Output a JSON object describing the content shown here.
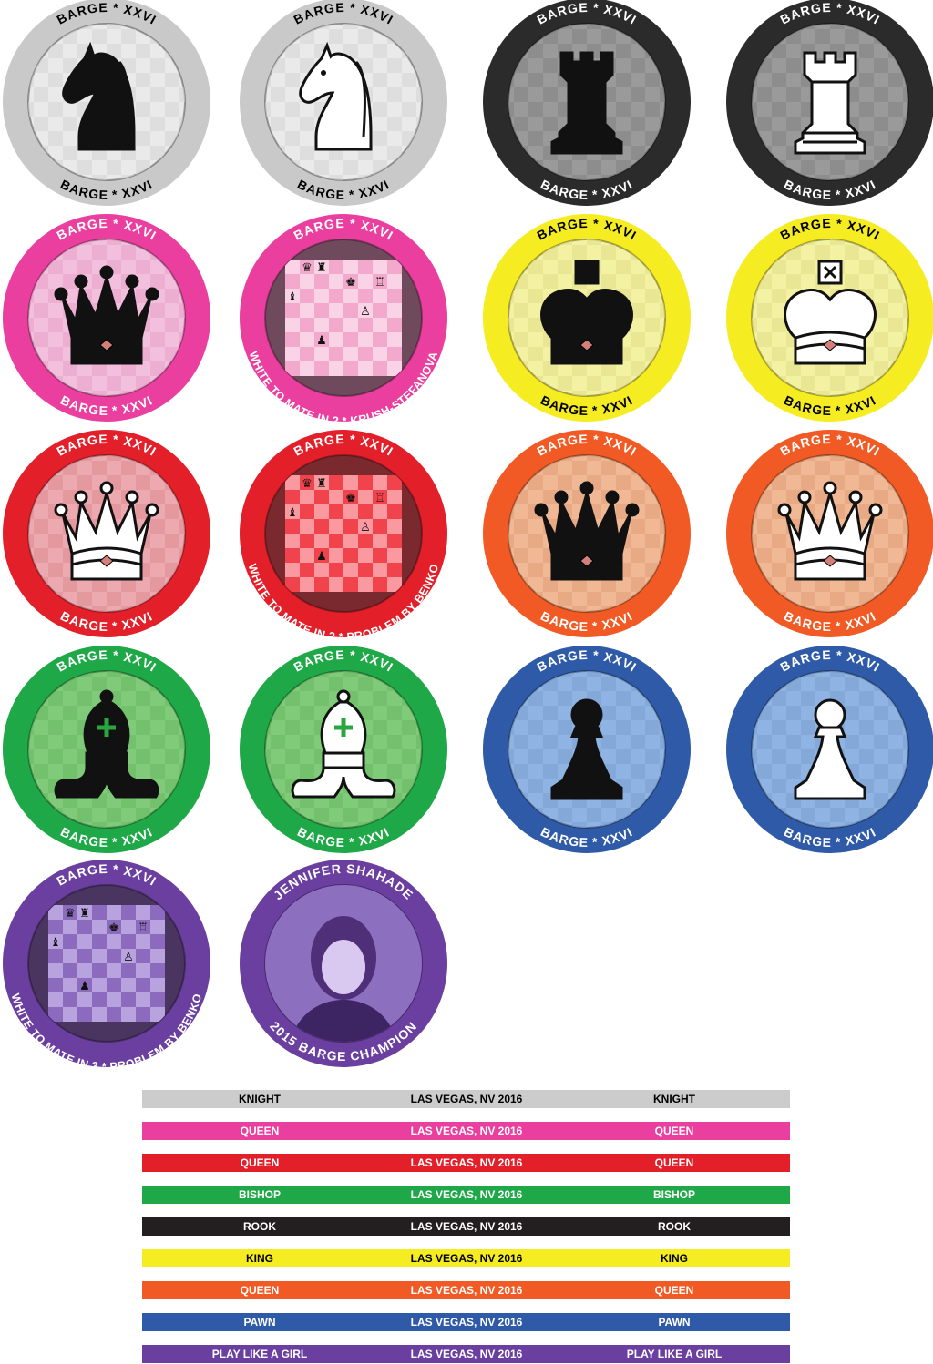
{
  "chips": [
    {
      "id": "knight-black",
      "ring": "#c9c9c9",
      "inner": "#eaeaea",
      "check": "#d5d5d5",
      "ringText": "#000000",
      "top": "BARGE * XXVI",
      "bottom": "BARGE * XXVI",
      "piece": "knight",
      "fill": "black"
    },
    {
      "id": "knight-white",
      "ring": "#c9c9c9",
      "inner": "#eaeaea",
      "check": "#d5d5d5",
      "ringText": "#000000",
      "top": "BARGE * XXVI",
      "bottom": "BARGE * XXVI",
      "piece": "knight",
      "fill": "white"
    },
    {
      "id": "rook-black",
      "ring": "#2b2b2b",
      "inner": "#9a9a9a",
      "check": "#858585",
      "ringText": "#ffffff",
      "top": "BARGE * XXVI",
      "bottom": "BARGE * XXVI",
      "piece": "rook",
      "fill": "black"
    },
    {
      "id": "rook-white",
      "ring": "#2b2b2b",
      "inner": "#9a9a9a",
      "check": "#858585",
      "ringText": "#ffffff",
      "top": "BARGE * XXVI",
      "bottom": "BARGE * XXVI",
      "piece": "rook",
      "fill": "white"
    },
    {
      "id": "queen-pink-black",
      "ring": "#ea3f9f",
      "inner": "#f2c0dc",
      "check": "#e7a3c9",
      "ringText": "#ffffff",
      "top": "BARGE * XXVI",
      "bottom": "BARGE * XXVI",
      "piece": "queen",
      "fill": "black"
    },
    {
      "id": "problem-pink",
      "ring": "#ea3f9f",
      "inner": "#6e4a5c",
      "check": "#f2a9cc",
      "light": "#fbd3e6",
      "ringText": "#ffffff",
      "top": "BARGE * XXVI",
      "arc": "WHITE TO MATE IN 2 * KRUSH-STEFANOVA",
      "piece": "board"
    },
    {
      "id": "king-yellow-black",
      "ring": "#f6ec22",
      "inner": "#f3f2a3",
      "check": "#e3e08a",
      "ringText": "#000000",
      "top": "BARGE * XXVI",
      "bottom": "BARGE * XXVI",
      "piece": "king",
      "fill": "black"
    },
    {
      "id": "king-yellow-white",
      "ring": "#f6ec22",
      "inner": "#f3f2a3",
      "check": "#e3e08a",
      "ringText": "#000000",
      "top": "BARGE * XXVI",
      "bottom": "BARGE * XXVI",
      "piece": "king",
      "fill": "white"
    },
    {
      "id": "queen-red-white",
      "ring": "#e31f2a",
      "inner": "#ecaab0",
      "check": "#df8e95",
      "ringText": "#ffffff",
      "top": "BARGE * XXVI",
      "bottom": "BARGE * XXVI",
      "piece": "queen",
      "fill": "white"
    },
    {
      "id": "problem-red",
      "ring": "#e31f2a",
      "inner": "#7a2a2e",
      "check": "#f0434c",
      "light": "#fa9aa0",
      "ringText": "#ffffff",
      "top": "BARGE * XXVI",
      "arc": "WHITE TO MATE IN 2 * PROBLEM BY BENKO",
      "piece": "board"
    },
    {
      "id": "queen-orange-black",
      "ring": "#f15a24",
      "inner": "#f0b894",
      "check": "#e3a07a",
      "ringText": "#ffffff",
      "top": "BARGE * XXVI",
      "bottom": "BARGE * XXVI",
      "piece": "queen",
      "fill": "black"
    },
    {
      "id": "queen-orange-white",
      "ring": "#f15a24",
      "inner": "#f0b894",
      "check": "#e3a07a",
      "ringText": "#ffffff",
      "top": "BARGE * XXVI",
      "bottom": "BARGE * XXVI",
      "piece": "queen",
      "fill": "white"
    },
    {
      "id": "bishop-green-black",
      "ring": "#1fa847",
      "inner": "#7fcb79",
      "check": "#6bbb66",
      "ringText": "#ffffff",
      "top": "BARGE * XXVI",
      "bottom": "BARGE * XXVI",
      "piece": "bishop",
      "fill": "black"
    },
    {
      "id": "bishop-green-white",
      "ring": "#1fa847",
      "inner": "#7fcb79",
      "check": "#6bbb66",
      "ringText": "#ffffff",
      "top": "BARGE * XXVI",
      "bottom": "BARGE * XXVI",
      "piece": "bishop",
      "fill": "white"
    },
    {
      "id": "pawn-blue-black",
      "ring": "#2e5aa8",
      "inner": "#8fb3e2",
      "check": "#7da2d4",
      "ringText": "#ffffff",
      "top": "BARGE * XXVI",
      "bottom": "BARGE * XXVI",
      "piece": "pawn",
      "fill": "black"
    },
    {
      "id": "pawn-blue-white",
      "ring": "#2e5aa8",
      "inner": "#8fb3e2",
      "check": "#7da2d4",
      "ringText": "#ffffff",
      "top": "BARGE * XXVI",
      "bottom": "BARGE * XXVI",
      "piece": "pawn",
      "fill": "white"
    },
    {
      "id": "problem-purple",
      "ring": "#6a3fa0",
      "inner": "#4a3560",
      "check": "#8c6bbf",
      "light": "#b9a3de",
      "ringText": "#ffffff",
      "top": "BARGE * XXVI",
      "arc": "WHITE TO MATE IN 3 * PROBLEM BY BENKO",
      "piece": "board"
    },
    {
      "id": "champion-purple",
      "ring": "#6a3fa0",
      "inner": "#8d6fc0",
      "check": "#8d6fc0",
      "ringText": "#ffffff",
      "top": "JENNIFER SHAHADE",
      "bottom": "2015 BARGE CHAMPION",
      "piece": "portrait"
    }
  ],
  "strips": [
    {
      "color": "#cccccc",
      "text": "#000000",
      "left": "KNIGHT",
      "center": "LAS VEGAS, NV 2016",
      "right": "KNIGHT"
    },
    {
      "color": "#ea3f9f",
      "text": "#ffffff",
      "left": "QUEEN",
      "center": "LAS VEGAS, NV 2016",
      "right": "QUEEN"
    },
    {
      "color": "#e31f2a",
      "text": "#ffffff",
      "left": "QUEEN",
      "center": "LAS VEGAS, NV 2016",
      "right": "QUEEN"
    },
    {
      "color": "#1fa847",
      "text": "#ffffff",
      "left": "BISHOP",
      "center": "LAS VEGAS, NV 2016",
      "right": "BISHOP"
    },
    {
      "color": "#231f20",
      "text": "#ffffff",
      "left": "ROOK",
      "center": "LAS VEGAS, NV 2016",
      "right": "ROOK"
    },
    {
      "color": "#f6ec22",
      "text": "#000000",
      "left": "KING",
      "center": "LAS VEGAS, NV 2016",
      "right": "KING"
    },
    {
      "color": "#f15a24",
      "text": "#ffffff",
      "left": "QUEEN",
      "center": "LAS VEGAS, NV 2016",
      "right": "QUEEN"
    },
    {
      "color": "#2e5aa8",
      "text": "#ffffff",
      "left": "PAWN",
      "center": "LAS VEGAS, NV 2016",
      "right": "PAWN"
    },
    {
      "color": "#6a3fa0",
      "text": "#ffffff",
      "left": "PLAY LIKE A GIRL",
      "center": "LAS VEGAS, NV 2016",
      "right": "PLAY LIKE A GIRL"
    }
  ]
}
